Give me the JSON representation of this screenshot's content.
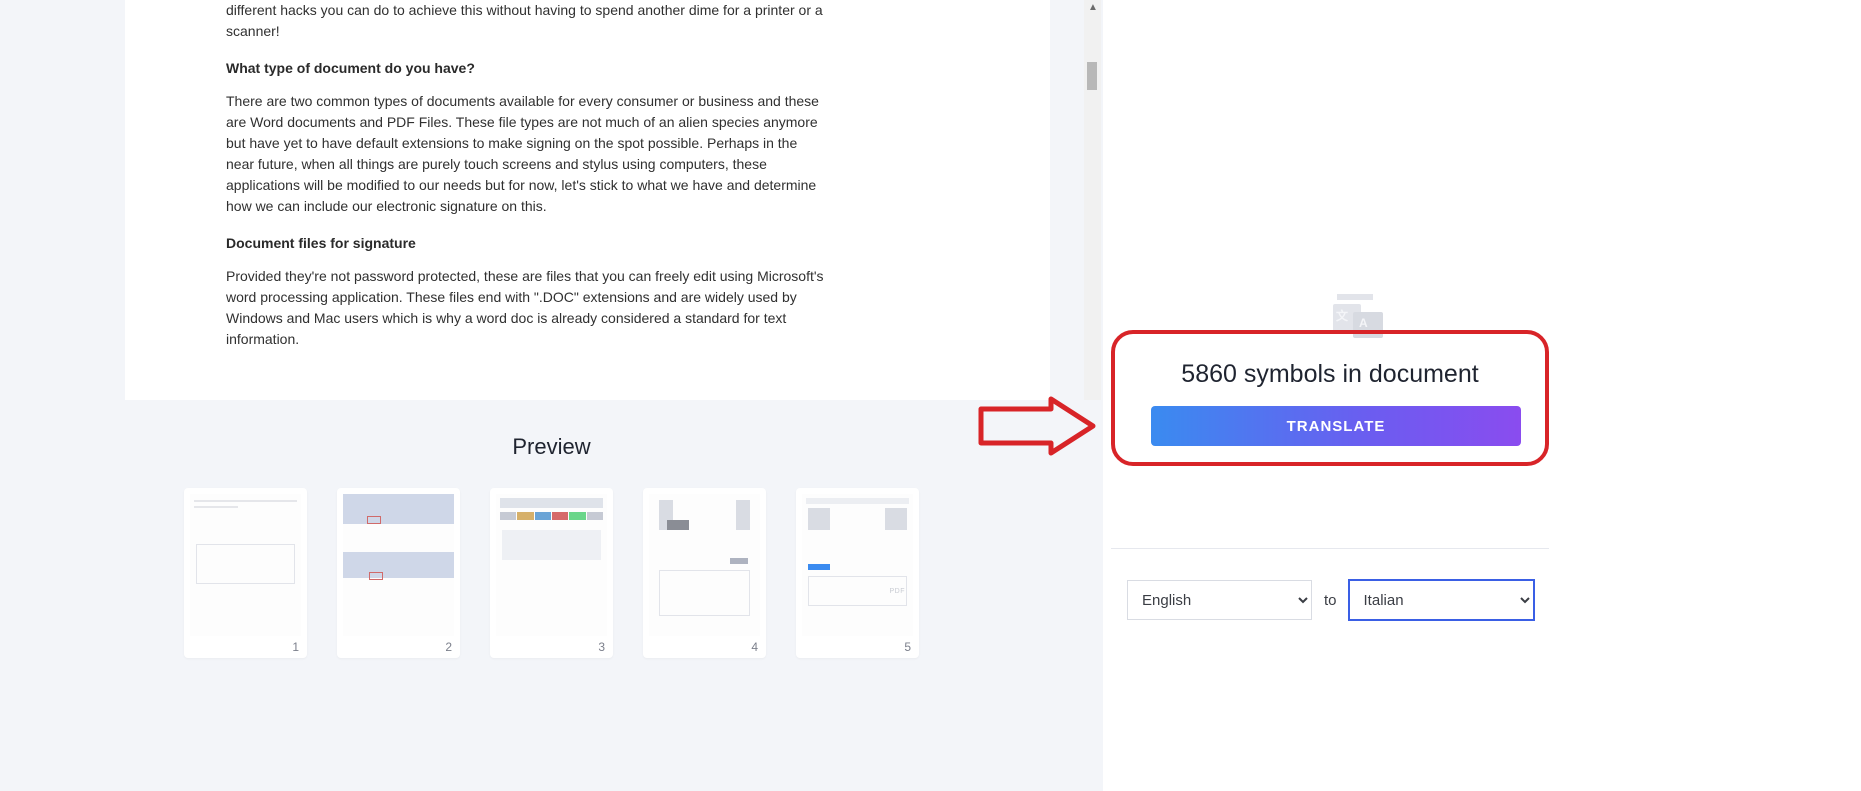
{
  "document": {
    "intro_fragment": "different hacks you can do to achieve this without having to spend another dime for a printer or a scanner!",
    "heading1": "What type of document do you have?",
    "para1": "There are two common types of documents available for every consumer or business and these are Word documents and PDF Files. These file types are not much of an alien species anymore but have yet to have default extensions to make signing on the spot possible. Perhaps in the near future, when all things are purely touch screens and stylus using computers, these applications will be modified to our needs but for now, let's stick to what we have and determine how we can include our electronic signature on this.",
    "heading2": "Document files for signature",
    "para2": "Provided they're not password protected, these are files that you can freely edit using Microsoft's word processing application. These files end with \".DOC\" extensions and are widely used by Windows and Mac users which is why a word doc is already considered a standard for text information."
  },
  "preview": {
    "title": "Preview",
    "pages": [
      "1",
      "2",
      "3",
      "4",
      "5"
    ]
  },
  "translate": {
    "symbols_text": "5860 symbols in document",
    "button_label": "TRANSLATE",
    "to_label": "to",
    "source_lang": "English",
    "target_lang": "Italian"
  }
}
